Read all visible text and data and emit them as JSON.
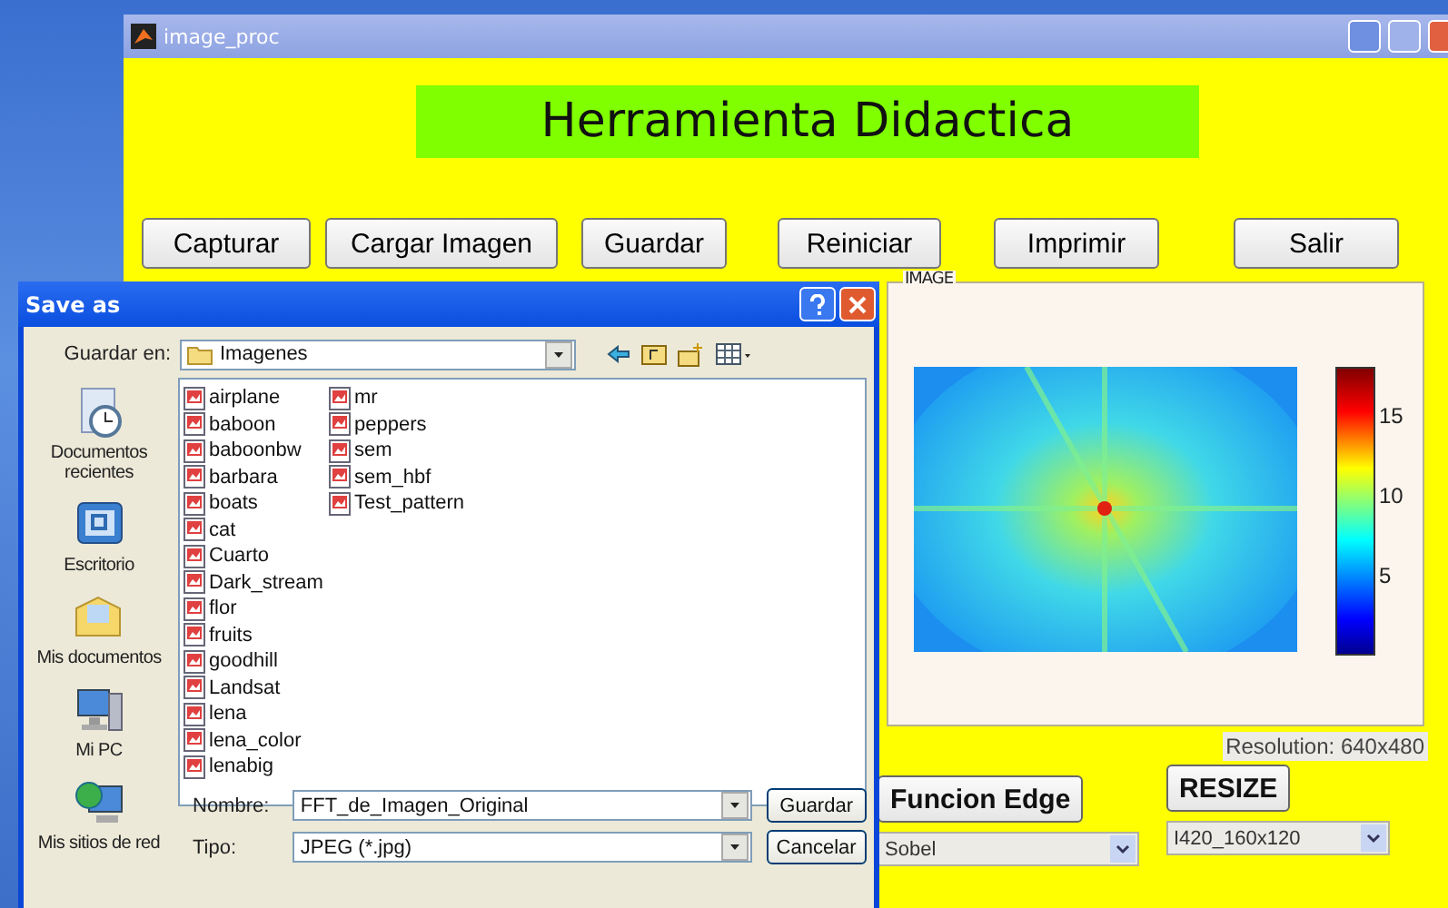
{
  "main_window": {
    "title": "image_proc",
    "heading": "Herramienta Didactica",
    "buttons": [
      "Capturar",
      "Cargar Imagen",
      "Guardar",
      "Reiniciar",
      "Imprimir",
      "Salir"
    ],
    "image_panel": {
      "label": "IMAGE",
      "colorbar_ticks": [
        "15",
        "10",
        "5"
      ]
    },
    "resolution": "Resolution: 640x480",
    "edge_button": "Funcion Edge",
    "edge_select": "Sobel",
    "resize_button": "RESIZE",
    "resize_select": "I420_160x120"
  },
  "dialog": {
    "title": "Save as",
    "look_in_label": "Guardar en:",
    "look_in": "Imagenes",
    "places": [
      {
        "kind": "recent",
        "label": "Documentos recientes"
      },
      {
        "kind": "desktop",
        "label": "Escritorio"
      },
      {
        "kind": "documents",
        "label": "Mis documentos"
      },
      {
        "kind": "computer",
        "label": "Mi PC"
      },
      {
        "kind": "network",
        "label": "Mis sitios de red"
      }
    ],
    "files": [
      [
        "airplane",
        "baboon",
        "baboonbw",
        "barbara",
        "boats",
        "cat",
        "Cuarto",
        "Dark_stream",
        "flor",
        "fruits",
        "goodhill",
        "Landsat",
        "lena",
        "lena_color",
        "lenabig"
      ],
      [
        "mr",
        "peppers",
        "sem",
        "sem_hbf",
        "Test_pattern"
      ]
    ],
    "name_label": "Nombre:",
    "name_value": "FFT_de_Imagen_Original",
    "type_label": "Tipo:",
    "type_value": "JPEG (*.jpg)",
    "save_button": "Guardar",
    "cancel_button": "Cancelar"
  }
}
